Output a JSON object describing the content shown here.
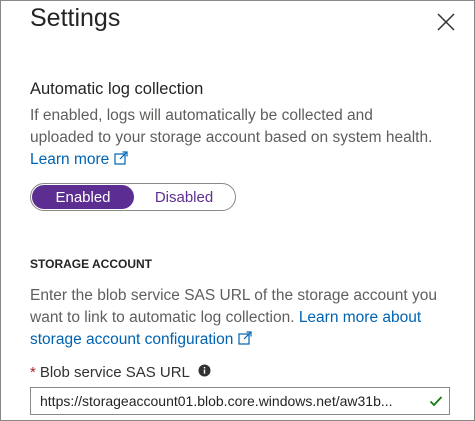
{
  "panel": {
    "title": "Settings"
  },
  "log_collection": {
    "heading": "Automatic log collection",
    "description_lines": [
      "If enabled, logs will automatically be collected and",
      "uploaded to your storage account based on system health."
    ],
    "learn_more": "Learn more",
    "toggle": {
      "enabled_label": "Enabled",
      "disabled_label": "Disabled",
      "selected": "Enabled"
    }
  },
  "storage_account": {
    "heading": "STORAGE ACCOUNT",
    "description_line1": "Enter the blob service SAS URL of the storage account you",
    "description_line2_text": "want to link to automatic log collection. ",
    "description_link_part1": "Learn more about",
    "description_link_part2": "storage account configuration",
    "field": {
      "required_marker": "*",
      "label": "Blob service SAS URL",
      "value": "https://storageaccount01.blob.core.windows.net/aw31b...",
      "valid": true
    }
  },
  "colors": {
    "accent": "#5c2e91",
    "link": "#0063b1",
    "valid": "#107c10",
    "required": "#a4262c"
  },
  "icons": {
    "close": "close-icon",
    "external_link": "external-link-icon",
    "info": "info-icon",
    "check": "check-icon"
  }
}
